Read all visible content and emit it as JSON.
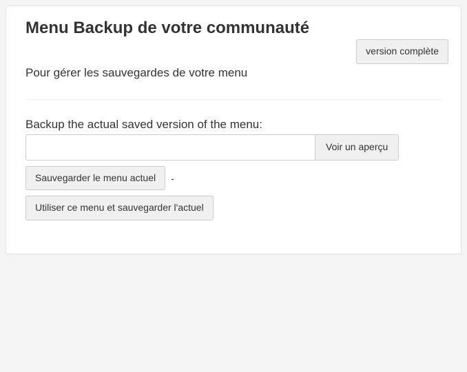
{
  "header": {
    "title": "Menu Backup de votre communauté",
    "version_button_label": "version complète"
  },
  "description": "Pour gérer les sauvegardes de votre menu",
  "section": {
    "label": "Backup the actual saved version of the menu:",
    "input_value": "",
    "preview_button_label": "Voir un aperçu",
    "save_button_label": "Sauvegarder le menu actuel",
    "separator_text": "-",
    "use_button_label": "Utiliser ce menu et sauvegarder l'actuel"
  }
}
